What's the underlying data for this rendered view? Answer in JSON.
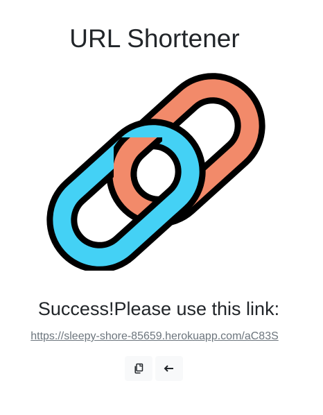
{
  "header": {
    "title": "URL Shortener"
  },
  "logo": {
    "icon": "chain-link-icon",
    "colors": {
      "left_link": "#44d1f5",
      "right_link": "#f28a6a",
      "outline": "#000000"
    }
  },
  "result": {
    "message": "Success!Please use this link:",
    "short_url": "https://sleepy-shore-85659.herokuapp.com/aC83S"
  },
  "actions": {
    "copy_icon": "copy-icon",
    "back_icon": "arrow-left-icon"
  }
}
